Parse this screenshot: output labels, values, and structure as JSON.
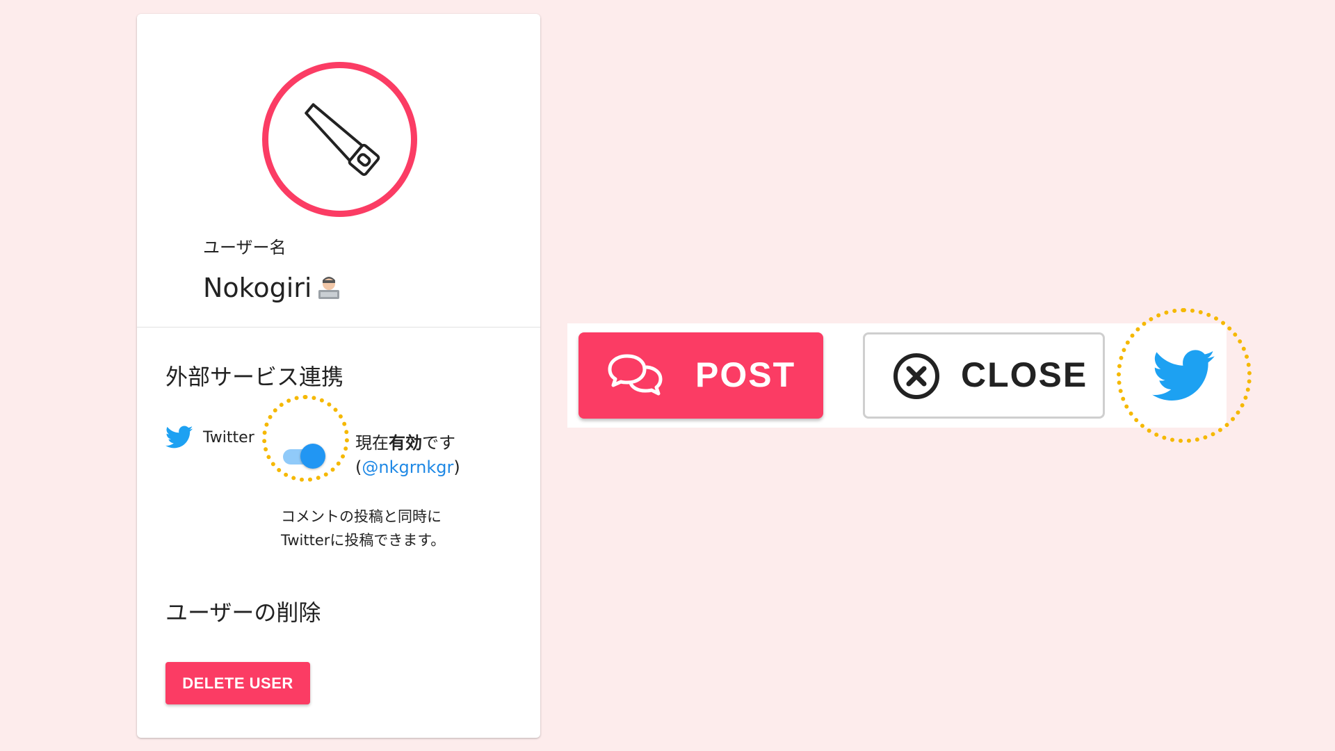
{
  "colors": {
    "background": "#fdecec",
    "brand_pink": "#fb3c64",
    "twitter_blue": "#1da1f2",
    "toggle_blue": "#2196f3",
    "highlight_dots": "#f5b800"
  },
  "profile": {
    "avatar_icon": "saw-icon",
    "username_label": "ユーザー名",
    "username": "Nokogiri",
    "username_emoji": "technologist-emoji"
  },
  "external_services": {
    "title": "外部サービス連携",
    "service": {
      "icon": "twitter-bird-icon",
      "name": "Twitter",
      "toggle_on": true,
      "status_prefix": "現在",
      "status_strong": "有効",
      "status_suffix": "です",
      "handle_open": "(",
      "handle": "@nkgrnkgr",
      "handle_close": ")",
      "description_line1": "コメントの投稿と同時に",
      "description_line2": "Twitterに投稿できます。"
    }
  },
  "delete_section": {
    "title": "ユーザーの削除",
    "button_label": "DELETE USER"
  },
  "actions": {
    "post": {
      "label": "POST",
      "icon": "speech-bubbles-icon"
    },
    "close": {
      "label": "CLOSE",
      "icon": "close-circle-icon"
    },
    "twitter": {
      "icon": "twitter-bird-icon"
    }
  }
}
